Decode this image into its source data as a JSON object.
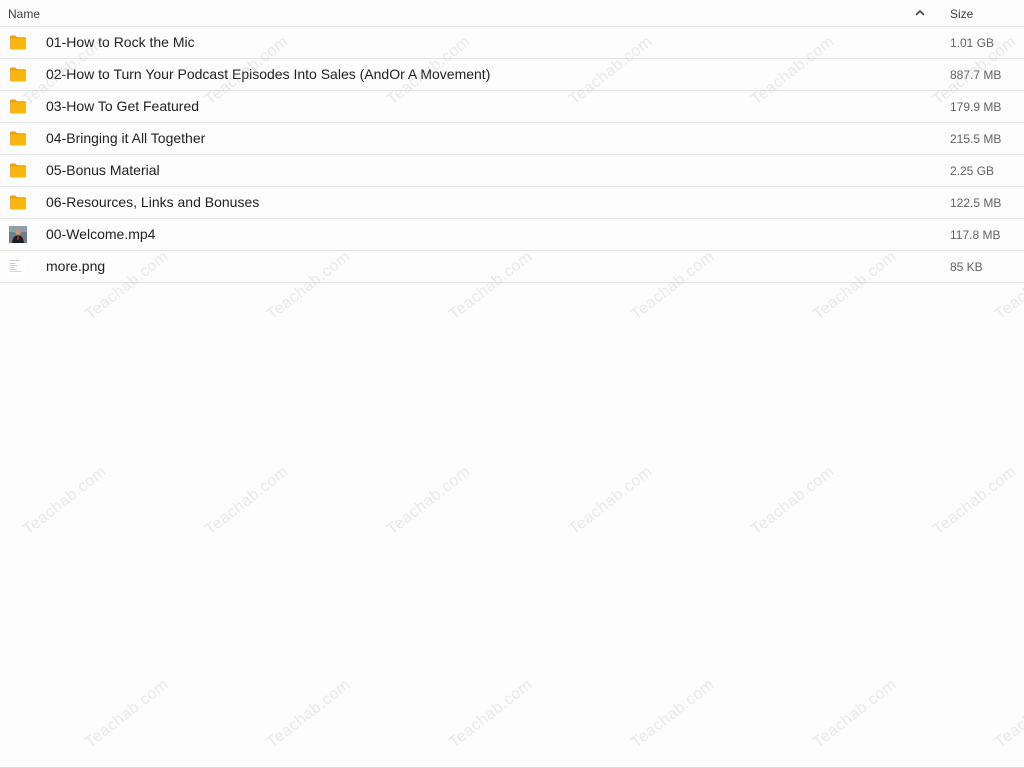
{
  "columns": {
    "name_label": "Name",
    "size_label": "Size"
  },
  "sort": {
    "icon": "chevron-up-icon",
    "direction": "ascending"
  },
  "files": [
    {
      "type": "folder",
      "icon": "folder-icon",
      "name": "01-How to Rock the Mic",
      "size": "1.01 GB"
    },
    {
      "type": "folder",
      "icon": "folder-icon",
      "name": "02-How to Turn Your Podcast Episodes Into Sales (AndOr A Movement)",
      "size": "887.7 MB"
    },
    {
      "type": "folder",
      "icon": "folder-icon",
      "name": "03-How To Get Featured",
      "size": "179.9 MB"
    },
    {
      "type": "folder",
      "icon": "folder-icon",
      "name": "04-Bringing it All Together",
      "size": "215.5 MB"
    },
    {
      "type": "folder",
      "icon": "folder-icon",
      "name": "05-Bonus Material",
      "size": "2.25 GB"
    },
    {
      "type": "folder",
      "icon": "folder-icon",
      "name": "06-Resources, Links and Bonuses",
      "size": "122.5 MB"
    },
    {
      "type": "video",
      "icon": "video-thumbnail-icon",
      "name": "00-Welcome.mp4",
      "size": "117.8 MB"
    },
    {
      "type": "image",
      "icon": "image-thumbnail-icon",
      "name": "more.png",
      "size": "85 KB"
    }
  ],
  "watermark": {
    "text": "Teachab.com"
  },
  "colors": {
    "folder": "#f9b710",
    "folder_tab": "#e8a30a",
    "text": "#202124",
    "size_text": "#5f6368",
    "divider": "#e6e6e6"
  }
}
